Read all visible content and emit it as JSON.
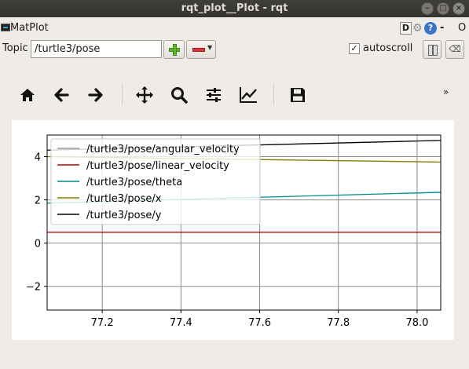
{
  "window": {
    "title": "rqt_plot__Plot - rqt"
  },
  "plugin": {
    "title": "MatPlot",
    "d_label": "D",
    "minus": "-",
    "o": "O"
  },
  "topic": {
    "label": "Topic",
    "value": "/turtle3/pose"
  },
  "autoscroll": {
    "label": "autoscroll",
    "checked": true,
    "check_glyph": "✓"
  },
  "toolbar": {
    "icons": [
      "home-icon",
      "back-arrow-icon",
      "forward-arrow-icon",
      "pan-move-icon",
      "zoom-icon",
      "configure-subplots-icon",
      "edit-axis-icon",
      "save-icon"
    ],
    "more": "»"
  },
  "colors": {
    "titlebar": "#3b3a36",
    "background": "#efebe7",
    "add": "#5fb52b",
    "remove": "#d9383a",
    "help": "#3a73c9"
  },
  "chart_data": {
    "type": "line",
    "title": "",
    "xlabel": "",
    "ylabel": "",
    "xlim": [
      77.06,
      78.06
    ],
    "ylim": [
      -3.1,
      5.0
    ],
    "xticks": [
      "77.2",
      "77.4",
      "77.6",
      "77.8",
      "78.0"
    ],
    "xtick_values": [
      77.2,
      77.4,
      77.6,
      77.8,
      78.0
    ],
    "yticks": [
      "−2",
      "0",
      "2",
      "4"
    ],
    "ytick_values": [
      -2,
      0,
      2,
      4
    ],
    "grid": true,
    "legend_position": "top-left",
    "series": [
      {
        "name": "/turtle3/pose/angular_velocity",
        "color": "#9b9b9b",
        "x": [
          77.06,
          78.06
        ],
        "y": [
          0.5,
          0.5
        ]
      },
      {
        "name": "/turtle3/pose/linear_velocity",
        "color": "#b20000",
        "x": [
          77.06,
          78.06
        ],
        "y": [
          0.5,
          0.5
        ]
      },
      {
        "name": "/turtle3/pose/theta",
        "color": "#008b8b",
        "x": [
          77.06,
          78.06
        ],
        "y": [
          1.85,
          2.35
        ]
      },
      {
        "name": "/turtle3/pose/x",
        "color": "#808000",
        "x": [
          77.06,
          78.06
        ],
        "y": [
          4.0,
          3.75
        ]
      },
      {
        "name": "/turtle3/pose/y",
        "color": "#000000",
        "x": [
          77.06,
          78.06
        ],
        "y": [
          4.3,
          4.75
        ]
      }
    ]
  }
}
